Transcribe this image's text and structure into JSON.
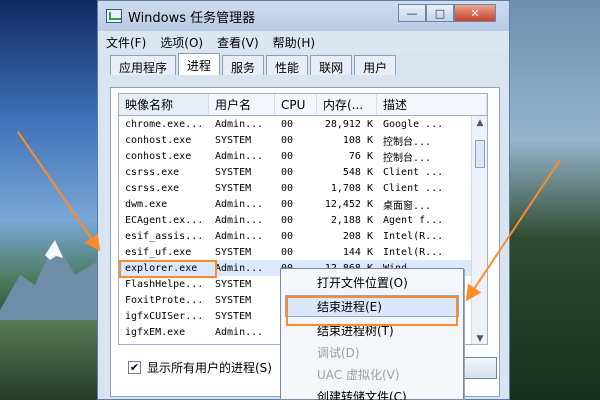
{
  "window": {
    "title": "Windows 任务管理器",
    "controls": [
      "—",
      "□",
      "✕"
    ]
  },
  "menu": [
    "文件(F)",
    "选项(O)",
    "查看(V)",
    "帮助(H)"
  ],
  "tabs": [
    "应用程序",
    "进程",
    "服务",
    "性能",
    "联网",
    "用户"
  ],
  "table": {
    "headers": [
      "映像名称",
      "用户名",
      "CPU",
      "内存(...",
      "描述"
    ],
    "rows": [
      [
        "chrome.exe...",
        "Admin...",
        "00",
        "28,912 K",
        "Google ..."
      ],
      [
        "conhost.exe",
        "SYSTEM",
        "00",
        "108 K",
        "控制台..."
      ],
      [
        "conhost.exe",
        "Admin...",
        "00",
        "76 K",
        "控制台..."
      ],
      [
        "csrss.exe",
        "SYSTEM",
        "00",
        "548 K",
        "Client ..."
      ],
      [
        "csrss.exe",
        "SYSTEM",
        "00",
        "1,708 K",
        "Client ..."
      ],
      [
        "dwm.exe",
        "Admin...",
        "00",
        "12,452 K",
        "桌面窗..."
      ],
      [
        "ECAgent.ex...",
        "Admin...",
        "00",
        "2,188 K",
        "Agent f..."
      ],
      [
        "esif_assis...",
        "Admin...",
        "00",
        "208 K",
        "Intel(R..."
      ],
      [
        "esif_uf.exe",
        "SYSTEM",
        "00",
        "144 K",
        "Intel(R..."
      ],
      [
        "explorer.exe",
        "Admin...",
        "00",
        "12,868 K",
        "Wind..."
      ],
      [
        "FlashHelpe...",
        "SYSTEM",
        "",
        "",
        ""
      ],
      [
        "FoxitProte...",
        "SYSTEM",
        "",
        "",
        ""
      ],
      [
        "igfxCUISer...",
        "SYSTEM",
        "",
        "",
        ""
      ],
      [
        "igfxEM.exe",
        "Admin...",
        "",
        "",
        ""
      ]
    ]
  },
  "checkbox": {
    "label": "显示所有用户的进程(S)",
    "checked": true
  },
  "context_menu": {
    "items": [
      {
        "label": "打开文件位置(O)",
        "state": "normal"
      },
      {
        "label": "结束进程(E)",
        "state": "selected"
      },
      {
        "label": "结束进程树(T)",
        "state": "normal"
      },
      {
        "label": "调试(D)",
        "state": "disabled"
      },
      {
        "label": "UAC 虚拟化(V)",
        "state": "disabled"
      },
      {
        "label": "创建转储文件(C)",
        "state": "normal"
      }
    ]
  },
  "colors": {
    "highlight": "#ff8a2a"
  }
}
